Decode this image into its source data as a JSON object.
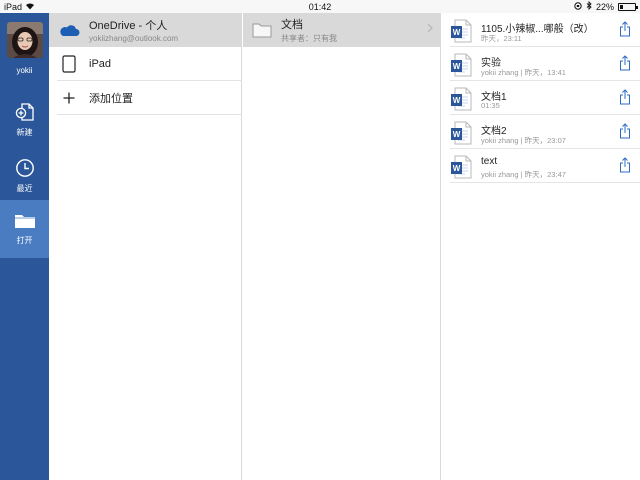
{
  "status_bar": {
    "device": "iPad",
    "time": "01:42",
    "battery_percent": "22%",
    "battery_level": 0.22
  },
  "nav": {
    "username": "yokii",
    "items": [
      {
        "label": "新建",
        "icon": "new-document-icon",
        "active": false
      },
      {
        "label": "最近",
        "icon": "clock-icon",
        "active": false
      },
      {
        "label": "打开",
        "icon": "folder-icon",
        "active": true
      }
    ]
  },
  "locations": {
    "onedrive": {
      "title": "OneDrive - 个人",
      "subtitle": "yokiizhang@outlook.com",
      "icon": "onedrive-cloud-icon",
      "selected": true
    },
    "ipad": {
      "title": "iPad",
      "icon": "ipad-icon"
    },
    "add_place": {
      "title": "添加位置",
      "icon": "plus-icon"
    }
  },
  "folders": [
    {
      "name": "文档",
      "meta": "共享者：只有我",
      "icon": "folder-icon",
      "selected": true
    }
  ],
  "files": [
    {
      "name": "1105.小辣椒...哪般（改）",
      "meta": "昨天，23:11",
      "icon": "word-doc-icon"
    },
    {
      "name": "实验",
      "meta": "yokii zhang | 昨天，13:41",
      "icon": "word-doc-icon"
    },
    {
      "name": "文档1",
      "meta": "01:35",
      "icon": "word-doc-icon"
    },
    {
      "name": "文档2",
      "meta": "yokii zhang | 昨天，23:07",
      "icon": "word-doc-icon"
    },
    {
      "name": "text",
      "meta": "yokii zhang | 昨天，23:47",
      "icon": "word-doc-icon"
    }
  ],
  "colors": {
    "nav_background": "#2b579a",
    "nav_active": "#4a7cc2",
    "selected_row": "#d9d9d9",
    "accent": "#2b6cc4"
  }
}
